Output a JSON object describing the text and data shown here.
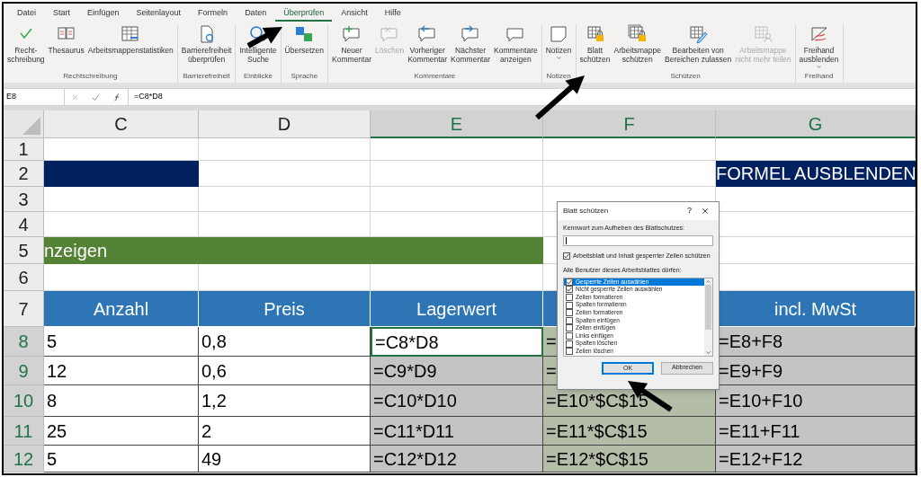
{
  "menu_tabs": [
    {
      "label": "Datei",
      "selected": false
    },
    {
      "label": "Start",
      "selected": false
    },
    {
      "label": "Einfügen",
      "selected": false
    },
    {
      "label": "Seitenlayout",
      "selected": false
    },
    {
      "label": "Formeln",
      "selected": false
    },
    {
      "label": "Daten",
      "selected": false
    },
    {
      "label": "Überprüfen",
      "selected": true
    },
    {
      "label": "Ansicht",
      "selected": false
    },
    {
      "label": "Hilfe",
      "selected": false
    }
  ],
  "ribbon_groups": [
    {
      "label": "Rechtschreibung",
      "buttons": [
        {
          "lines": [
            "Recht-",
            "schreibung"
          ],
          "disabled": false,
          "dropdown": false
        },
        {
          "lines": [
            "Thesaurus"
          ],
          "disabled": false,
          "dropdown": false
        },
        {
          "lines": [
            "Arbeitsmappenstatistiken"
          ],
          "disabled": false,
          "dropdown": false
        }
      ]
    },
    {
      "label": "Barrierefreiheit",
      "buttons": [
        {
          "lines": [
            "Barrierefreiheit",
            "überprüfen"
          ],
          "disabled": false,
          "dropdown": false
        }
      ]
    },
    {
      "label": "Einblicke",
      "buttons": [
        {
          "lines": [
            "Intelligente",
            "Suche"
          ],
          "disabled": false,
          "dropdown": false
        }
      ]
    },
    {
      "label": "Sprache",
      "buttons": [
        {
          "lines": [
            "Übersetzen"
          ],
          "disabled": false,
          "dropdown": false
        }
      ]
    },
    {
      "label": "Kommentare",
      "buttons": [
        {
          "lines": [
            "Neuer",
            "Kommentar"
          ],
          "disabled": false,
          "dropdown": false
        },
        {
          "lines": [
            "Löschen"
          ],
          "disabled": true,
          "dropdown": false
        },
        {
          "lines": [
            "Vorheriger",
            "Kommentar"
          ],
          "disabled": false,
          "dropdown": false
        },
        {
          "lines": [
            "Nächster",
            "Kommentar"
          ],
          "disabled": false,
          "dropdown": false
        },
        {
          "lines": [
            "Kommentare",
            "anzeigen"
          ],
          "disabled": false,
          "dropdown": false
        }
      ]
    },
    {
      "label": "Notizen",
      "buttons": [
        {
          "lines": [
            "Notizen"
          ],
          "disabled": false,
          "dropdown": true
        }
      ]
    },
    {
      "label": "Schützen",
      "buttons": [
        {
          "lines": [
            "Blatt",
            "schützen"
          ],
          "disabled": false,
          "dropdown": false
        },
        {
          "lines": [
            "Arbeitsmappe",
            "schützen"
          ],
          "disabled": false,
          "dropdown": false
        },
        {
          "lines": [
            "Bearbeiten von",
            "Bereichen zulassen"
          ],
          "disabled": false,
          "dropdown": false
        },
        {
          "lines": [
            "Arbeitsmappe",
            "nicht mehr teilen"
          ],
          "disabled": true,
          "dropdown": false
        }
      ]
    },
    {
      "label": "Freihand",
      "buttons": [
        {
          "lines": [
            "Freihand",
            "ausblenden"
          ],
          "disabled": false,
          "dropdown": true
        }
      ]
    }
  ],
  "formula_bar": {
    "name_box": "E8",
    "formula": "=C8*D8"
  },
  "columns": [
    {
      "label": "C",
      "selected": false
    },
    {
      "label": "D",
      "selected": false
    },
    {
      "label": "E",
      "selected": true
    },
    {
      "label": "F",
      "selected": true
    },
    {
      "label": "G",
      "selected": true
    }
  ],
  "rows": [
    {
      "number": "1",
      "selected": false,
      "cells": [
        {
          "kind": "blank"
        },
        {
          "kind": "blank"
        },
        {
          "kind": "blank"
        },
        {
          "kind": "blank"
        },
        {
          "kind": "blank"
        }
      ]
    },
    {
      "number": "2",
      "selected": false,
      "cells": [
        {
          "kind": "navy"
        },
        {
          "kind": "blank"
        },
        {
          "kind": "blank"
        },
        {
          "kind": "blank"
        },
        {
          "kind": "navy",
          "text": "FORMEL AUSBLENDEN"
        }
      ]
    },
    {
      "number": "3",
      "selected": false,
      "cells": [
        {
          "kind": "blank"
        },
        {
          "kind": "blank"
        },
        {
          "kind": "blank"
        },
        {
          "kind": "blank"
        },
        {
          "kind": "blank"
        }
      ]
    },
    {
      "number": "4",
      "selected": false,
      "cells": [
        {
          "kind": "blank"
        },
        {
          "kind": "blank"
        },
        {
          "kind": "blank"
        },
        {
          "kind": "blank"
        },
        {
          "kind": "blank"
        }
      ]
    },
    {
      "number": "5",
      "selected": false,
      "cells": [
        {
          "kind": "green",
          "text": "nzeigen"
        },
        {
          "kind": "green"
        },
        {
          "kind": "green"
        },
        {
          "kind": "blank"
        },
        {
          "kind": "blank"
        }
      ]
    },
    {
      "number": "6",
      "selected": false,
      "cells": [
        {
          "kind": "blank"
        },
        {
          "kind": "blank"
        },
        {
          "kind": "blank"
        },
        {
          "kind": "blank"
        },
        {
          "kind": "blank"
        }
      ]
    },
    {
      "number": "7",
      "selected": false,
      "cells": [
        {
          "kind": "header",
          "text": "Anzahl"
        },
        {
          "kind": "header",
          "text": "Preis"
        },
        {
          "kind": "header",
          "text": "Lagerwert"
        },
        {
          "kind": "header"
        },
        {
          "kind": "header",
          "text": "incl. MwSt"
        }
      ]
    },
    {
      "number": "8",
      "selected": true,
      "cells": [
        {
          "kind": "value",
          "text": "5"
        },
        {
          "kind": "value",
          "text": "0,8"
        },
        {
          "kind": "active",
          "text": "=C8*D8"
        },
        {
          "kind": "tinted",
          "text": "="
        },
        {
          "kind": "selected",
          "text": "=E8+F8"
        }
      ]
    },
    {
      "number": "9",
      "selected": true,
      "cells": [
        {
          "kind": "value",
          "text": "12"
        },
        {
          "kind": "value",
          "text": "0,6"
        },
        {
          "kind": "selected",
          "text": "=C9*D9"
        },
        {
          "kind": "tinted",
          "text": "="
        },
        {
          "kind": "selected",
          "text": "=E9+F9"
        }
      ]
    },
    {
      "number": "10",
      "selected": true,
      "cells": [
        {
          "kind": "value",
          "text": "8"
        },
        {
          "kind": "value",
          "text": "1,2"
        },
        {
          "kind": "selected",
          "text": "=C10*D10"
        },
        {
          "kind": "tinted",
          "text": "=E10*$C$15"
        },
        {
          "kind": "selected",
          "text": "=E10+F10"
        }
      ]
    },
    {
      "number": "11",
      "selected": true,
      "cells": [
        {
          "kind": "value",
          "text": "25"
        },
        {
          "kind": "value",
          "text": "2"
        },
        {
          "kind": "selected",
          "text": "=C11*D11"
        },
        {
          "kind": "tinted",
          "text": "=E11*$C$15"
        },
        {
          "kind": "selected",
          "text": "=E11+F11"
        }
      ]
    },
    {
      "number": "12",
      "selected": true,
      "cells": [
        {
          "kind": "value",
          "text": "5"
        },
        {
          "kind": "value",
          "text": "49"
        },
        {
          "kind": "selected",
          "text": "=C12*D12"
        },
        {
          "kind": "tinted",
          "text": "=E12*$C$15"
        },
        {
          "kind": "selected",
          "text": "=E12+F12"
        }
      ]
    }
  ],
  "dialog": {
    "title": "Blatt schützen",
    "help": "?",
    "password_label": "Kennwort zum Aufheben des Blattschutzes:",
    "protect_option": {
      "label": "Arbeitsblatt und Inhalt gesperrter Zellen schützen",
      "checked": true
    },
    "list_label": "Alle Benutzer dieses Arbeitsblattes dürfen:",
    "permissions": [
      {
        "label": "Gesperrte Zellen auswählen",
        "checked": true,
        "selected": true
      },
      {
        "label": "Nicht gesperrte Zellen auswählen",
        "checked": true,
        "selected": false
      },
      {
        "label": "Zellen formatieren",
        "checked": false,
        "selected": false
      },
      {
        "label": "Spalten formatieren",
        "checked": false,
        "selected": false
      },
      {
        "label": "Zeilen formatieren",
        "checked": false,
        "selected": false
      },
      {
        "label": "Spalten einfügen",
        "checked": false,
        "selected": false
      },
      {
        "label": "Zeilen einfügen",
        "checked": false,
        "selected": false
      },
      {
        "label": "Links einfügen",
        "checked": false,
        "selected": false
      },
      {
        "label": "Spalten löschen",
        "checked": false,
        "selected": false
      },
      {
        "label": "Zeilen löschen",
        "checked": false,
        "selected": false
      }
    ],
    "buttons": [
      {
        "label": "OK",
        "default": true
      },
      {
        "label": "Abbrechen",
        "default": false
      }
    ]
  }
}
